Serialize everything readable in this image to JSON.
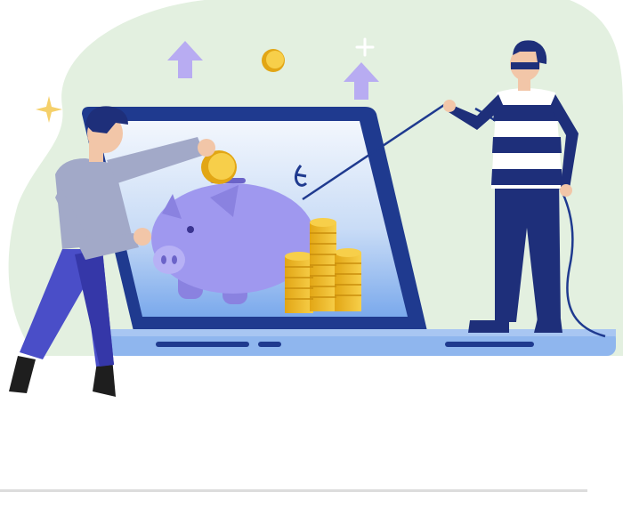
{
  "illustration": {
    "subject": "online-banking-fraud",
    "elements": [
      "background-blob",
      "laptop",
      "piggy-bank",
      "coin-stacks",
      "saver-person",
      "thief-person",
      "fishing-line-hook",
      "up-arrow-icon",
      "sparkle-icon",
      "coin-icon"
    ]
  },
  "colors": {
    "blob": "#e3f0e0",
    "laptop_frame": "#1f3a8f",
    "laptop_base": "#8fb6ee",
    "screen_top": "#f2f6fc",
    "screen_bottom": "#7aa9ec",
    "piggy": "#9f98ef",
    "coin": "#f0c02d",
    "arrow": "#b8acf2",
    "thief_shirt_stripe": "#1e2f7a",
    "saver_sweater": "#a2a9c8",
    "saver_pants": "#4a4ec8",
    "skin": "#f2c6a8",
    "hair": "#1e2f7a",
    "divider": "#dcdcdc"
  }
}
